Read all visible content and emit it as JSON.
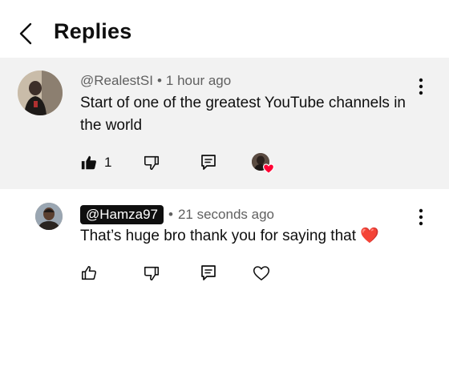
{
  "header": {
    "title": "Replies"
  },
  "parent_comment": {
    "author": "@RealestSI",
    "time": "1 hour ago",
    "text": "Start of one of the greatest YouTube channels in the world",
    "like_count": "1"
  },
  "reply": {
    "author": "@Hamza97",
    "time": "21 seconds ago",
    "text": "That’s huge bro thank you for saying that",
    "emoji": "❤️"
  },
  "separator": "•",
  "colors": {
    "heart": "#ff0033",
    "badge_bg": "#0f0f0f",
    "parent_bg": "#f2f2f2"
  }
}
